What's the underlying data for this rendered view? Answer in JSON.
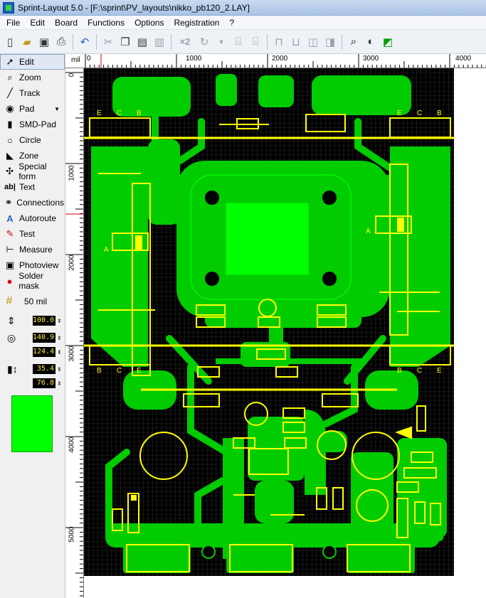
{
  "window": {
    "title": "Sprint-Layout 5.0 - [F:\\sprint\\PV_layouts\\nikko_pb120_2.LAY]"
  },
  "menu": [
    "File",
    "Edit",
    "Board",
    "Functions",
    "Options",
    "Registration",
    "?"
  ],
  "toolbar": {
    "icons": [
      "new-icon",
      "open-icon",
      "save-icon",
      "print-icon",
      "undo-icon",
      "cut-icon",
      "copy-icon",
      "paste-icon",
      "delete-icon",
      "mirror-x2-icon",
      "rotate-icon",
      "align-icon",
      "group-icon",
      "ungroup-icon",
      "lock-icon",
      "unlock-icon",
      "hide-icon",
      "show-icon",
      "zoom-icon",
      "contrast-icon",
      "drc-icon"
    ],
    "x2_label": "×2"
  },
  "tools": [
    {
      "name": "edit",
      "label": "Edit",
      "icon": "arrow-icon",
      "selected": true
    },
    {
      "name": "zoom",
      "label": "Zoom",
      "icon": "magnifier-icon"
    },
    {
      "name": "track",
      "label": "Track",
      "icon": "track-icon"
    },
    {
      "name": "pad",
      "label": "Pad",
      "icon": "pad-icon",
      "dropdown": true
    },
    {
      "name": "smd-pad",
      "label": "SMD-Pad",
      "icon": "smd-icon"
    },
    {
      "name": "circle",
      "label": "Circle",
      "icon": "circle-icon"
    },
    {
      "name": "zone",
      "label": "Zone",
      "icon": "zone-icon"
    },
    {
      "name": "special-form",
      "label": "Special form",
      "icon": "special-form-icon"
    },
    {
      "name": "text",
      "label": "Text",
      "icon": "text-icon"
    },
    {
      "name": "connections",
      "label": "Connections",
      "icon": "connections-icon"
    },
    {
      "name": "autoroute",
      "label": "Autoroute",
      "icon": "autoroute-icon"
    },
    {
      "name": "test",
      "label": "Test",
      "icon": "test-icon"
    },
    {
      "name": "measure",
      "label": "Measure",
      "icon": "measure-icon"
    },
    {
      "name": "photoview",
      "label": "Photoview",
      "icon": "camera-icon"
    },
    {
      "name": "solder-mask",
      "label": "Solder mask",
      "icon": "solder-mask-icon"
    }
  ],
  "grid": {
    "label": "50 mil"
  },
  "values": {
    "track_width": "100.0",
    "pad_outer": "140.9",
    "pad_inner": "124.4",
    "smd_w": "35.4",
    "smd_h": "76.8"
  },
  "colors": {
    "copper": "#00cc00",
    "silk": "#ffff00",
    "board": "#000000",
    "layer_swatch": "#00ff00"
  },
  "ruler": {
    "unit": "mil",
    "top_labels": [
      "0",
      "1000",
      "2000",
      "3000",
      "4000"
    ],
    "left_labels": [
      "0",
      "1000",
      "2000",
      "3000",
      "4000",
      "5000"
    ]
  },
  "pcb": {
    "labels_top_left": [
      "E",
      "C",
      "B"
    ],
    "labels_top_right": [
      "E",
      "C",
      "B"
    ],
    "labels_bottom_left": [
      "B",
      "C",
      "E"
    ],
    "labels_bottom_right": [
      "B",
      "C",
      "E"
    ],
    "anode_label": "A"
  }
}
